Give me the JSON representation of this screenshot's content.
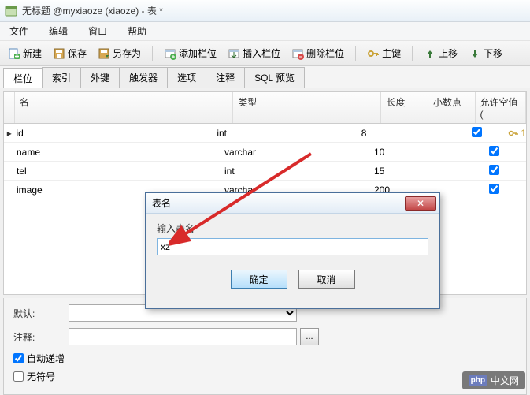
{
  "window": {
    "title": "无标题 @myxiaoze (xiaoze) - 表 *"
  },
  "menu": {
    "file": "文件",
    "edit": "编辑",
    "window": "窗口",
    "help": "帮助"
  },
  "toolbar": {
    "new": "新建",
    "save": "保存",
    "saveas": "另存为",
    "addcol": "添加栏位",
    "insertcol": "插入栏位",
    "delcol": "删除栏位",
    "pk": "主键",
    "moveup": "上移",
    "movedown": "下移"
  },
  "tabs": {
    "fields": "栏位",
    "indexes": "索引",
    "fk": "外键",
    "triggers": "触发器",
    "options": "选项",
    "comments": "注释",
    "sqlpreview": "SQL 预览"
  },
  "columns": {
    "name": "名",
    "type": "类型",
    "length": "长度",
    "decimal": "小数点",
    "allownull": "允许空值 ("
  },
  "rows": [
    {
      "name": "id",
      "type": "int",
      "length": "8",
      "decimal": "",
      "allownull": true,
      "pk": true,
      "pknum": "1"
    },
    {
      "name": "name",
      "type": "varchar",
      "length": "10",
      "decimal": "",
      "allownull": true,
      "pk": false,
      "pknum": ""
    },
    {
      "name": "tel",
      "type": "int",
      "length": "15",
      "decimal": "",
      "allownull": true,
      "pk": false,
      "pknum": ""
    },
    {
      "name": "image",
      "type": "varchar",
      "length": "200",
      "decimal": "",
      "allownull": true,
      "pk": false,
      "pknum": ""
    }
  ],
  "panel": {
    "default": "默认:",
    "comment": "注释:",
    "autoinc": "自动递增",
    "unsigned": "无符号",
    "browse": "..."
  },
  "dialog": {
    "title": "表名",
    "label": "输入表名",
    "value": "xz",
    "ok": "确定",
    "cancel": "取消",
    "close": "✕"
  },
  "watermark": {
    "php": "php",
    "text": "中文网"
  }
}
